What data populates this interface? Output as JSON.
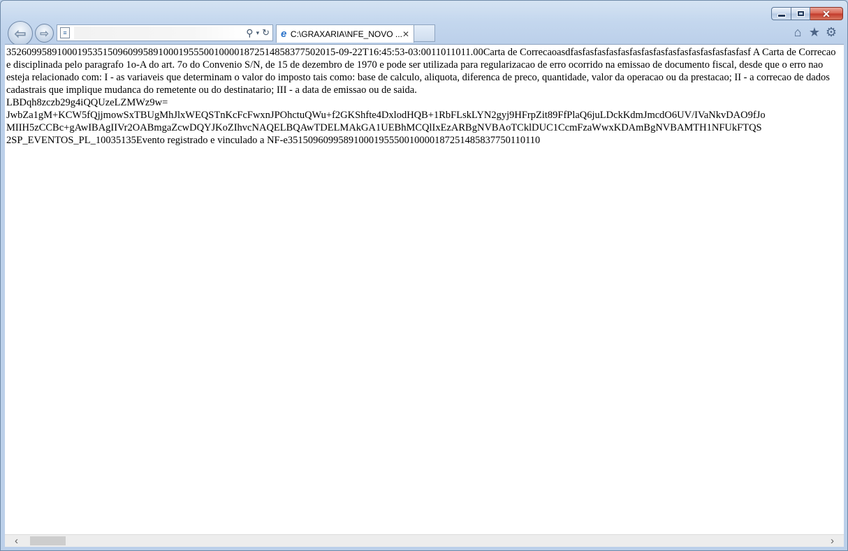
{
  "window": {
    "caption": {
      "minimize": "–",
      "maximize": "□",
      "close": "✕"
    }
  },
  "nav": {
    "back_icon": "arrow-left-icon",
    "forward_icon": "arrow-right-icon",
    "back_glyph": "⇦",
    "forward_glyph": "⇨"
  },
  "address": {
    "value": "",
    "search_glyph": "⚲",
    "dropdown_glyph": "▾",
    "refresh_glyph": "↻"
  },
  "tabs": [
    {
      "title": "C:\\GRAXARIA\\NFE_NOVO ...",
      "close_glyph": "✕"
    }
  ],
  "toolbar": {
    "home_glyph": "⌂",
    "favorites_glyph": "★",
    "tools_glyph": "⚙"
  },
  "document": {
    "line1": "35260995891000195351509609958910001955500100001872514858377502015-09-22T16:45:53-03:0011011011.00Carta de Correcaoasdfasfasfasfasfasfasfasfasfasfasfasfasfasfasfasf A Carta de Correcao e disciplinada pelo paragrafo 1o-A do art. 7o do Convenio S/N, de 15 de dezembro de 1970 e pode ser utilizada para regularizacao de erro ocorrido na emissao de documento fiscal, desde que o erro nao esteja relacionado com: I - as variaveis que determinam o valor do imposto tais como: base de calculo, aliquota, diferenca de preco, quantidade, valor da operacao ou da prestacao; II - a correcao de dados cadastrais que implique mudanca do remetente ou do destinatario; III - a data de emissao ou de saida.",
    "line2": "LBDqh8zczb29g4iQQUzeLZMWz9w=",
    "line3": "JwbZa1gM+KCW5fQjjmowSxTBUgMhJlxWEQSTnKcFcFwxnJPOhctuQWu+f2GKShfte4DxlodHQB+1RbFLskLYN2gyj9HFrpZit89FfPlaQ6juLDckKdmJmcdO6UV/IVaNkvDAO9fJo",
    "line4": "MIIH5zCCBc+gAwIBAgIIVr2OABmgaZcwDQYJKoZIhvcNAQELBQAwTDELMAkGA1UEBhMCQlIxEzARBgNVBAoTCklDUC1CcmFzaWwxKDAmBgNVBAMTH1NFUkFTQS",
    "line5": "2SP_EVENTOS_PL_10035135Evento registrado e vinculado a NF-e35150960995891000195550010000187251485837750110110"
  },
  "scrollbar": {
    "left_glyph": "‹",
    "right_glyph": "›",
    "position_fraction": 0.0
  }
}
